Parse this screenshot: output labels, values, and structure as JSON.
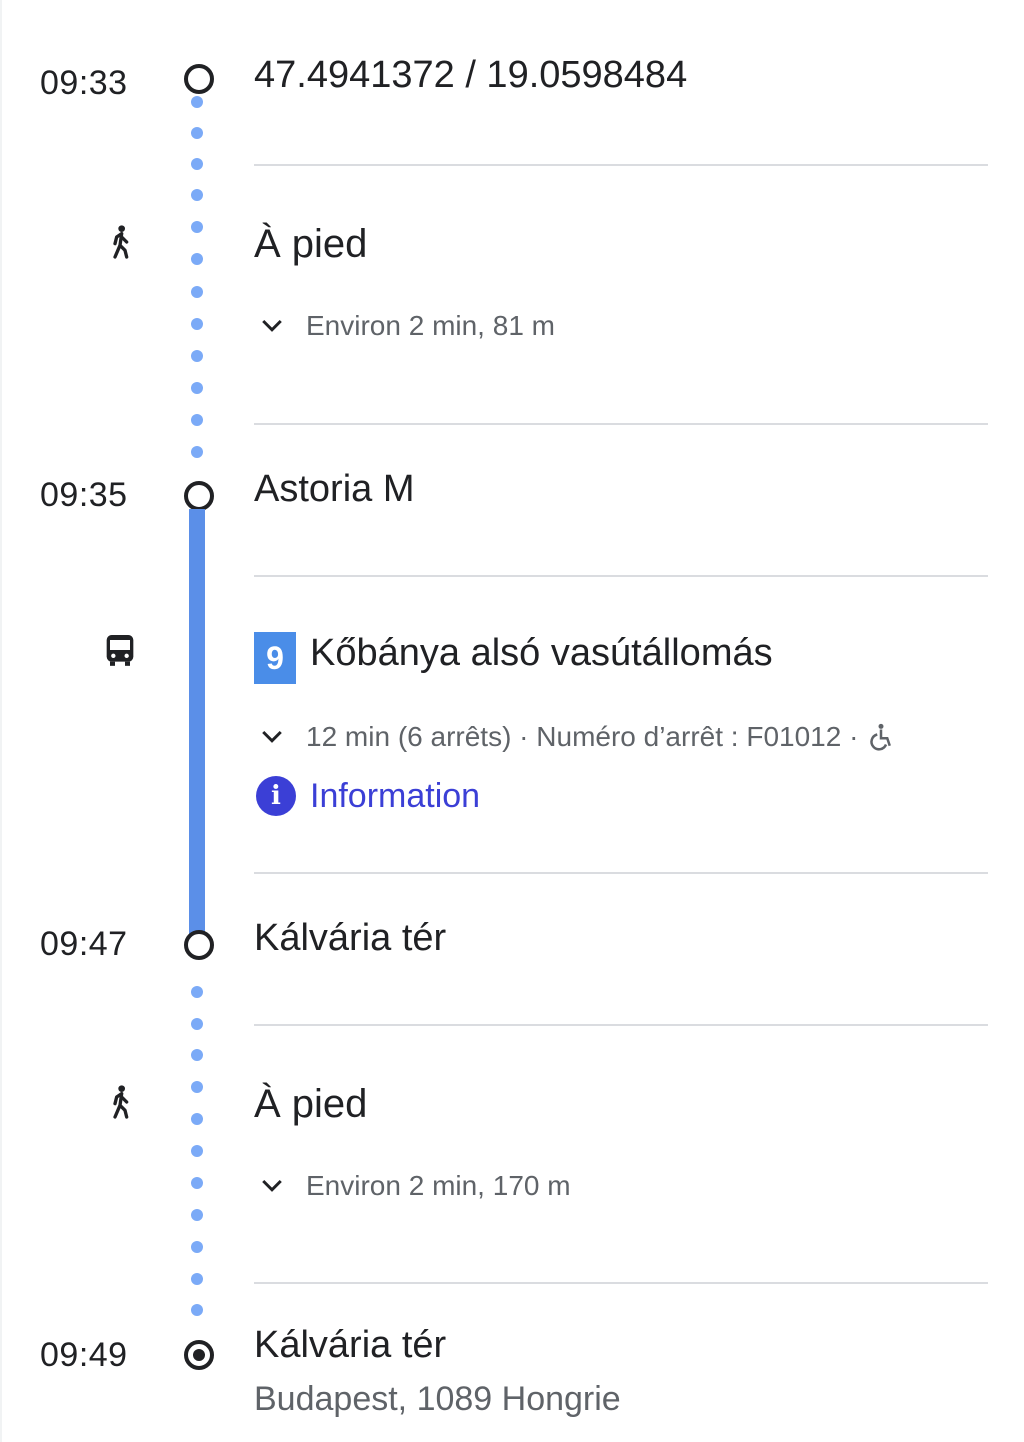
{
  "steps": [
    {
      "time": "09:33",
      "title": "47.4941372 / 19.0598484"
    },
    {
      "mode": "À pied",
      "detail": "Environ 2 min, 81 m",
      "mode_icon": "walk-icon"
    },
    {
      "time": "09:35",
      "title": "Astoria M"
    },
    {
      "mode_icon": "bus-icon",
      "route_number": "9",
      "route_name": "Kőbánya alsó vasútállomás",
      "detail": "12 min (6 arrêts) · Numéro d’arrêt : F01012 ·",
      "accessibility_icon": "wheelchair-icon",
      "info_label": "Information",
      "line_color": "#5b8fe8"
    },
    {
      "time": "09:47",
      "title": "Kálvária tér"
    },
    {
      "mode": "À pied",
      "detail": "Environ 2 min, 170 m",
      "mode_icon": "walk-icon"
    },
    {
      "time": "09:49",
      "title": "Kálvária tér",
      "address": "Budapest, 1089 Hongrie"
    }
  ],
  "colors": {
    "walk_dots": "#7baaf7",
    "bus_line": "#5b8fe8",
    "link": "#3b3fd6",
    "divider": "#dadce0"
  }
}
